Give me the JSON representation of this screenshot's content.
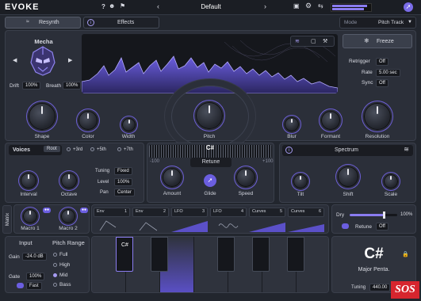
{
  "app": {
    "logo": "EVOKE",
    "preset": "Default",
    "help": "?",
    "accent": "#7a6ce8"
  },
  "topbar": {
    "icons": [
      "user-icon",
      "bell-icon",
      "save-icon",
      "gear-icon",
      "shuffle-icon"
    ]
  },
  "tabs": {
    "resynth": "Resynth",
    "effects": "Effects",
    "mode_label": "Mode",
    "mode_value": "Pitch Track"
  },
  "source": {
    "name": "Mecha",
    "drift_label": "Drift",
    "drift_value": "100%",
    "breath_label": "Breath",
    "breath_value": "100%"
  },
  "freeze": {
    "label": "Freeze",
    "retrigger_label": "Retrigger",
    "retrigger_value": "Off",
    "rate_label": "Rate",
    "rate_value": "5.00 sec",
    "sync_label": "Sync",
    "sync_value": "Off"
  },
  "knobs_row1": [
    "Shape",
    "Color",
    "Width",
    "Pitch",
    "Blur",
    "Formant",
    "Resolution"
  ],
  "voices": {
    "label": "Voices",
    "root": "Root",
    "third": "+3rd",
    "fifth": "+5th",
    "seventh": "+7th",
    "tuning_label": "Tuning",
    "tuning_value": "Fixed",
    "level_label": "Level",
    "level_value": "100%",
    "pan_label": "Pan",
    "pan_value": "Center",
    "interval": "Interval",
    "octave": "Octave"
  },
  "retune": {
    "note": "C#",
    "min": "-100",
    "max": "+100",
    "label": "Retune",
    "amount": "Amount",
    "glide": "Glide",
    "speed": "Speed"
  },
  "spectrum": {
    "label": "Spectrum",
    "tilt": "Tilt",
    "shift": "Shift",
    "scale": "Scale"
  },
  "matrix": {
    "label": "Matrix",
    "macro1": "Macro 1",
    "macro2": "Macro 2",
    "slots": [
      {
        "name": "Env",
        "n": "1"
      },
      {
        "name": "Env",
        "n": "2"
      },
      {
        "name": "LFO",
        "n": "3"
      },
      {
        "name": "LFO",
        "n": "4"
      },
      {
        "name": "Curves",
        "n": "5"
      },
      {
        "name": "Curves",
        "n": "6"
      }
    ]
  },
  "mix": {
    "dry_label": "Dry",
    "dry_value": "100%",
    "retune_label": "Retune",
    "retune_value": "Off",
    "dry_fraction": 0.72
  },
  "input": {
    "title": "Input",
    "gain_label": "Gain",
    "gain_value": "-24.0 dB",
    "gate_label": "Gate",
    "gate_value": "100%",
    "fast": "Fast"
  },
  "pitch_range": {
    "title": "Pitch Range",
    "options": [
      "Full",
      "High",
      "Mid",
      "Bass"
    ],
    "selected": "Mid"
  },
  "keyboard": {
    "note": "C#"
  },
  "key_display": {
    "note": "C#",
    "scale": "Major Penta.",
    "tuning_label": "Tuning",
    "tuning_value": "440.00"
  },
  "watermark": "SOS"
}
